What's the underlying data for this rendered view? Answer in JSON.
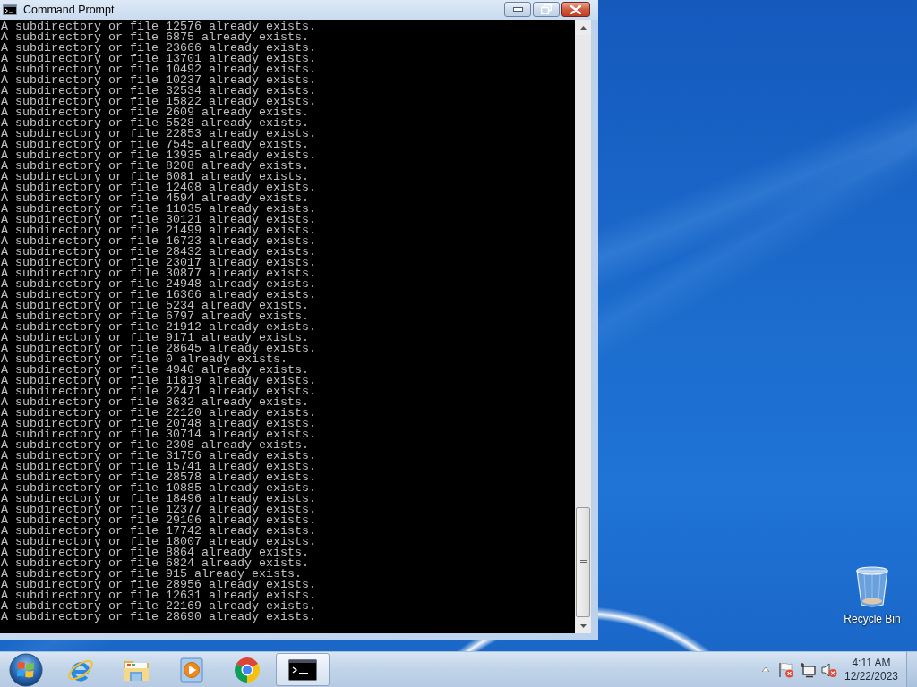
{
  "window": {
    "title": "Command Prompt"
  },
  "console": {
    "lines": [
      "A subdirectory or file 12576 already exists.",
      "A subdirectory or file 6875 already exists.",
      "A subdirectory or file 23666 already exists.",
      "A subdirectory or file 13701 already exists.",
      "A subdirectory or file 10492 already exists.",
      "A subdirectory or file 10237 already exists.",
      "A subdirectory or file 32534 already exists.",
      "A subdirectory or file 15822 already exists.",
      "A subdirectory or file 2609 already exists.",
      "A subdirectory or file 5528 already exists.",
      "A subdirectory or file 22853 already exists.",
      "A subdirectory or file 7545 already exists.",
      "A subdirectory or file 13935 already exists.",
      "A subdirectory or file 8208 already exists.",
      "A subdirectory or file 6081 already exists.",
      "A subdirectory or file 12408 already exists.",
      "A subdirectory or file 4594 already exists.",
      "A subdirectory or file 11035 already exists.",
      "A subdirectory or file 30121 already exists.",
      "A subdirectory or file 21499 already exists.",
      "A subdirectory or file 16723 already exists.",
      "A subdirectory or file 28432 already exists.",
      "A subdirectory or file 23017 already exists.",
      "A subdirectory or file 30877 already exists.",
      "A subdirectory or file 24948 already exists.",
      "A subdirectory or file 16366 already exists.",
      "A subdirectory or file 5234 already exists.",
      "A subdirectory or file 6797 already exists.",
      "A subdirectory or file 21912 already exists.",
      "A subdirectory or file 9171 already exists.",
      "A subdirectory or file 28645 already exists.",
      "A subdirectory or file 0 already exists.",
      "A subdirectory or file 4940 already exists.",
      "A subdirectory or file 11819 already exists.",
      "A subdirectory or file 22471 already exists.",
      "A subdirectory or file 3632 already exists.",
      "A subdirectory or file 22120 already exists.",
      "A subdirectory or file 20748 already exists.",
      "A subdirectory or file 30714 already exists.",
      "A subdirectory or file 2308 already exists.",
      "A subdirectory or file 31756 already exists.",
      "A subdirectory or file 15741 already exists.",
      "A subdirectory or file 28578 already exists.",
      "A subdirectory or file 10885 already exists.",
      "A subdirectory or file 18496 already exists.",
      "A subdirectory or file 12377 already exists.",
      "A subdirectory or file 29106 already exists.",
      "A subdirectory or file 17742 already exists.",
      "A subdirectory or file 18007 already exists.",
      "A subdirectory or file 8864 already exists.",
      "A subdirectory or file 6824 already exists.",
      "A subdirectory or file 915 already exists.",
      "A subdirectory or file 28956 already exists.",
      "A subdirectory or file 12631 already exists.",
      "A subdirectory or file 22169 already exists.",
      "A subdirectory or file 28690 already exists."
    ]
  },
  "desktop": {
    "icons": [
      {
        "label": "Recycle Bin"
      }
    ]
  },
  "taskbar": {
    "apps": [
      {
        "kind": "browser",
        "selected": false
      },
      {
        "kind": "folder",
        "selected": false
      },
      {
        "kind": "media",
        "selected": false
      },
      {
        "kind": "web",
        "selected": false
      },
      {
        "kind": "terminal",
        "selected": true
      }
    ],
    "clock": {
      "time": "4:11 AM",
      "date": "12/22/2023"
    }
  }
}
